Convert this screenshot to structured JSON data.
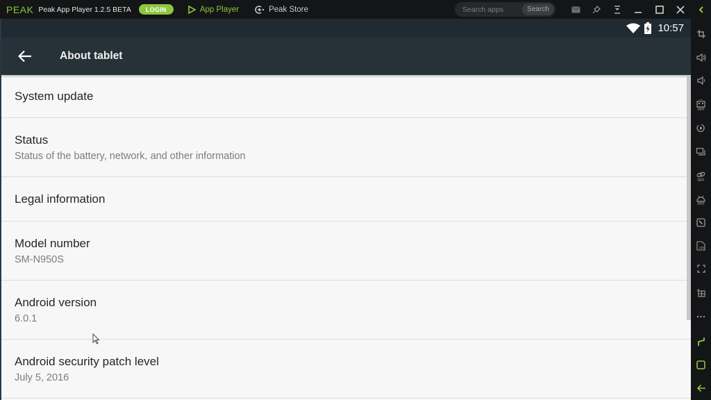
{
  "window": {
    "logo": "PEAK",
    "app_name": "Peak App Player 1.2.5 BETA",
    "login_label": "LOGIN",
    "nav": [
      {
        "label": "App Player",
        "icon": "play-triangle-icon",
        "active": true
      },
      {
        "label": "Peak Store",
        "icon": "store-icon",
        "active": false
      }
    ],
    "search": {
      "placeholder": "Search apps",
      "value": "",
      "button_label": "Search"
    },
    "controls": [
      "mail-icon",
      "pin-icon",
      "download-icon",
      "minimize-icon",
      "maximize-icon",
      "close-icon",
      "collapse-sidebar-icon"
    ]
  },
  "colors": {
    "accent": "#8dc63f",
    "titlebar_bg": "#141516",
    "statusbar_bg": "#1f2a33",
    "appbar_bg": "#263238",
    "list_bg": "#f7f7f7"
  },
  "statusbar": {
    "wifi_icon": "wifi-icon",
    "battery_icon": "battery-charging-icon",
    "time": "10:57"
  },
  "appbar": {
    "back_icon": "arrow-back-icon",
    "title": "About tablet"
  },
  "settings": [
    {
      "title": "System update",
      "subtitle": null
    },
    {
      "title": "Status",
      "subtitle": "Status of the battery, network, and other information"
    },
    {
      "title": "Legal information",
      "subtitle": null
    },
    {
      "title": "Model number",
      "subtitle": "SM-N950S"
    },
    {
      "title": "Android version",
      "subtitle": "6.0.1"
    },
    {
      "title": "Android security patch level",
      "subtitle": "July 5, 2016"
    }
  ],
  "scroll": {
    "visible_fraction": 0.64,
    "position": 0
  },
  "sidebar": {
    "off_label": "OFF",
    "buttons": [
      {
        "icon": "crop-icon",
        "off": false
      },
      {
        "icon": "volume-up-icon",
        "off": false
      },
      {
        "icon": "volume-down-icon",
        "off": false
      },
      {
        "icon": "keyboard-mapping-icon",
        "off": true
      },
      {
        "icon": "rotate-icon",
        "off": false
      },
      {
        "icon": "multi-window-icon",
        "off": false
      },
      {
        "icon": "link-icon",
        "off": true
      },
      {
        "icon": "android-icon",
        "off": true
      },
      {
        "icon": "shake-icon",
        "off": false
      },
      {
        "icon": "install-apk-icon",
        "off": false
      },
      {
        "icon": "fullscreen-icon",
        "off": false
      },
      {
        "icon": "add-app-icon",
        "off": false
      },
      {
        "icon": "more-icon",
        "off": false
      },
      {
        "icon": "recent-apps-icon",
        "off": false
      },
      {
        "icon": "home-icon",
        "off": false
      },
      {
        "icon": "android-back-icon",
        "off": false
      }
    ]
  }
}
